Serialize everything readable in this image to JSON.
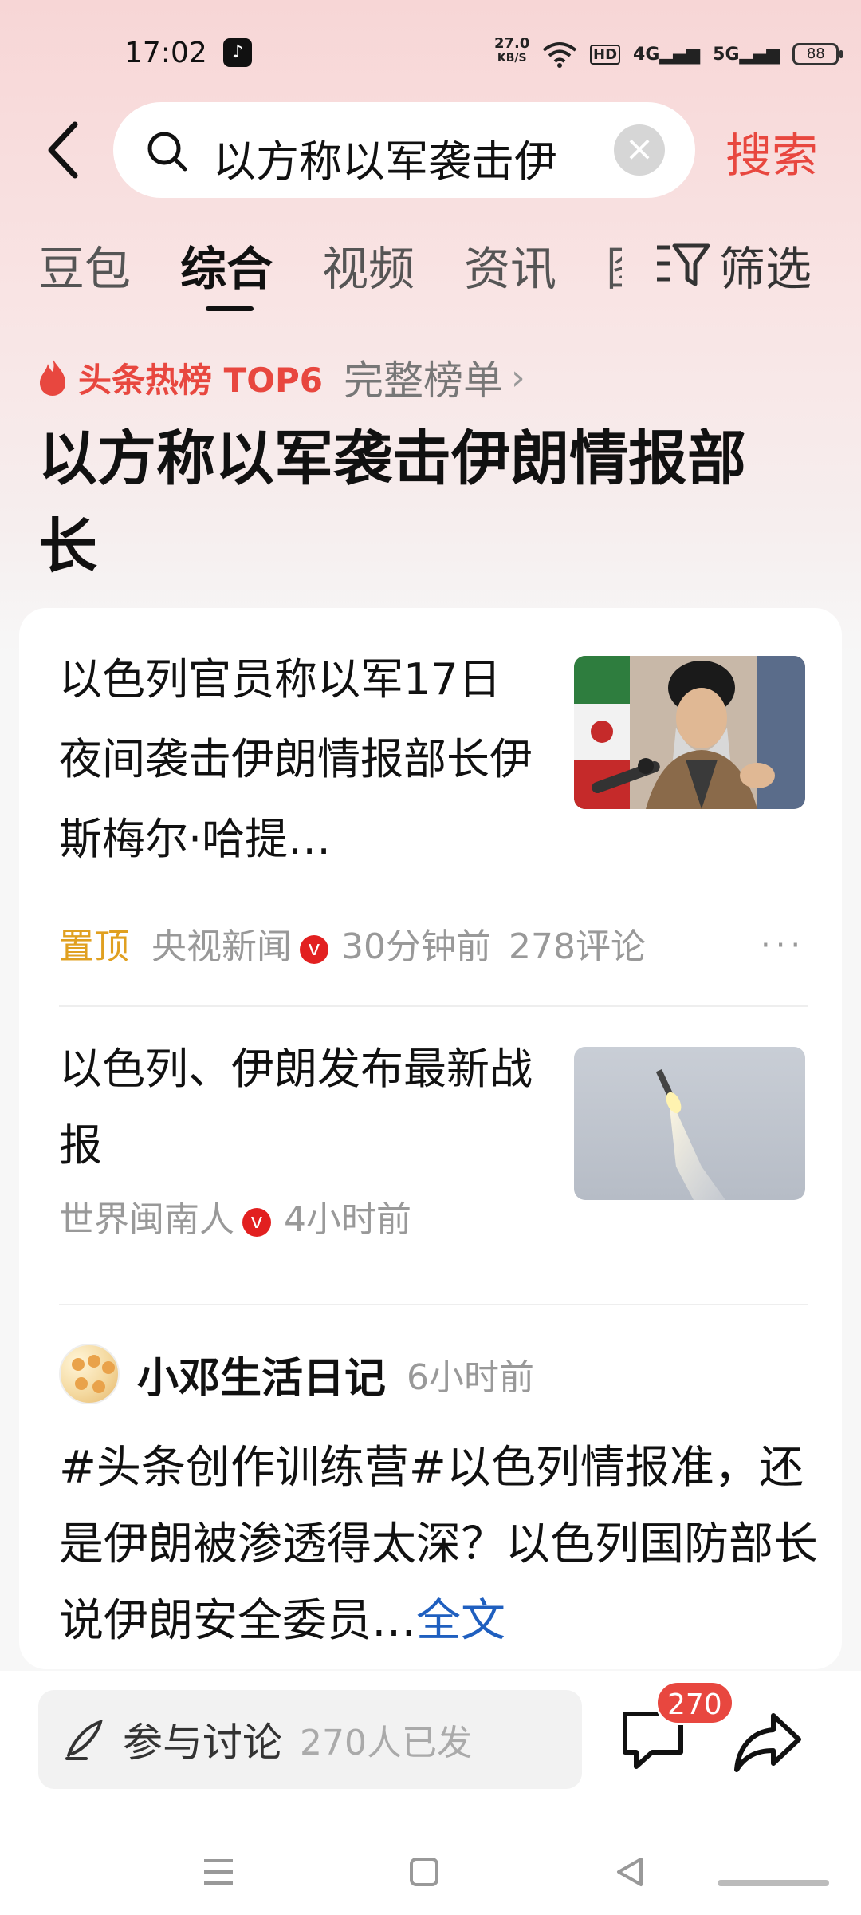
{
  "status_bar": {
    "time": "17:02",
    "net_speed_value": "27.0",
    "net_speed_unit": "KB/S",
    "hd_label": "HD",
    "signal_1": "4G",
    "signal_2": "5G",
    "battery": "88"
  },
  "search": {
    "query": "以方称以军袭击伊",
    "submit_label": "搜索"
  },
  "tabs": [
    {
      "label": "豆包",
      "active": false
    },
    {
      "label": "综合",
      "active": true
    },
    {
      "label": "视频",
      "active": false
    },
    {
      "label": "资讯",
      "active": false
    },
    {
      "label": "图",
      "active": false
    }
  ],
  "filter_label": "筛选",
  "hot_list": {
    "badge": "头条热榜 TOP6",
    "full_list_label": "完整榜单",
    "title": "以方称以军袭击伊朗情报部长"
  },
  "results": [
    {
      "title": "以色列官员称以军17日夜间袭击伊朗情报部长伊斯梅尔·哈提…",
      "pinned_label": "置顶",
      "source": "央视新闻",
      "verified": "v",
      "time": "30分钟前",
      "comments": "278评论",
      "more": "···"
    },
    {
      "title": "以色列、伊朗发布最新战报",
      "source": "世界闽南人",
      "verified": "v",
      "time": "4小时前"
    }
  ],
  "post": {
    "author": "小邓生活日记",
    "time": "6小时前",
    "text": "#头条创作训练营#以色列情报准，还是伊朗被渗透得太深？以色列国防部长说伊朗安全委员…",
    "full_text_label": "全文"
  },
  "bottom_bar": {
    "discuss_label": "参与讨论",
    "discuss_count": "270人已发",
    "comment_badge": "270"
  },
  "colors": {
    "accent": "#e8473f",
    "pinned": "#e0a020",
    "link": "#1f5fbf"
  }
}
